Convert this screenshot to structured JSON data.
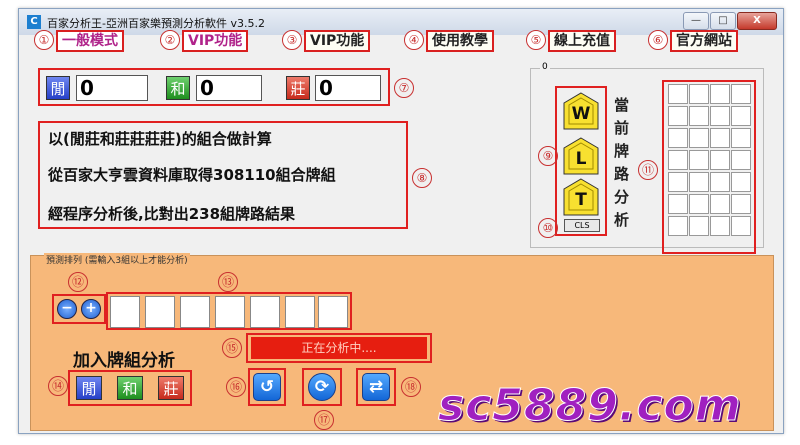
{
  "window": {
    "title": "百家分析王-亞洲百家樂預測分析軟件 v3.5.2",
    "app_icon": "C",
    "minimize": "—",
    "maximize": "□",
    "close": "X"
  },
  "tabs": [
    {
      "num": "①",
      "label": "一般模式"
    },
    {
      "num": "②",
      "label": "VIP功能"
    },
    {
      "num": "③",
      "label": "VIP功能"
    },
    {
      "num": "④",
      "label": "使用教學"
    },
    {
      "num": "⑤",
      "label": "線上充值"
    },
    {
      "num": "⑥",
      "label": "官方網站"
    }
  ],
  "counters": [
    {
      "char": "閒",
      "value": "0",
      "color": "#2540c8"
    },
    {
      "char": "和",
      "value": "0",
      "color": "#1e8e1e"
    },
    {
      "char": "莊",
      "value": "0",
      "color": "#c62a1c"
    }
  ],
  "info_lines": [
    "以(閒莊和莊莊莊莊)的組合做計算",
    "從百家大亨雲資料庫取得308110組合牌組",
    "經程序分析後,比對出238組牌路結果"
  ],
  "group_label": "0",
  "predict": {
    "w": "W",
    "l": "L",
    "t": "T",
    "cls": "CLS"
  },
  "vertical_label": [
    "當",
    "前",
    "牌",
    "路",
    "分",
    "析"
  ],
  "orange": {
    "title": "預測排列 (需輸入3組以上才能分析)",
    "minus": "−",
    "plus": "+",
    "status": "正在分析中....",
    "add_label": "加入牌組分析",
    "buttons": [
      "閒",
      "和",
      "莊"
    ],
    "undo_icon": "↺",
    "refresh_icon": "⟳",
    "shuffle_icon": "⇄"
  },
  "markers": {
    "m7": "⑦",
    "m8": "⑧",
    "m9": "⑨",
    "m10": "⑩",
    "m11": "⑪",
    "m12": "⑫",
    "m13": "⑬",
    "m14": "⑭",
    "m15": "⑮",
    "m16": "⑯",
    "m17": "⑰",
    "m18": "⑱"
  },
  "watermark": "sc5889.com"
}
